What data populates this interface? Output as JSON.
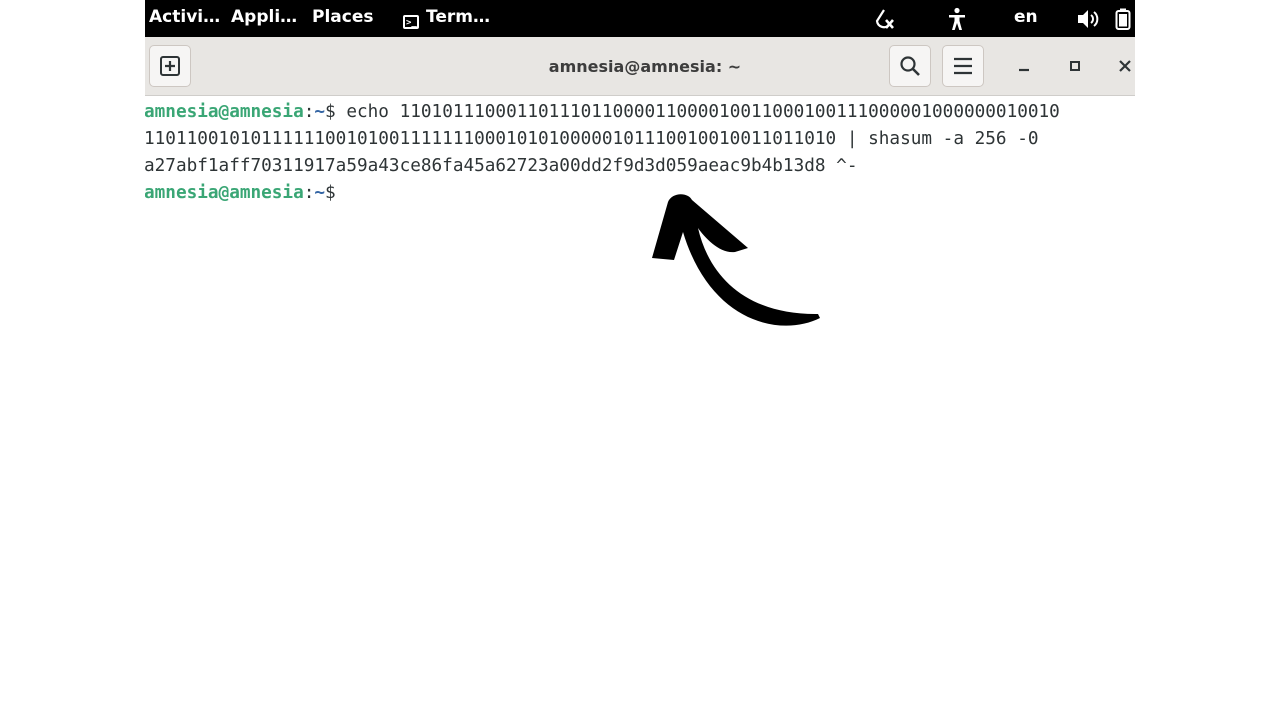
{
  "topbar": {
    "activities": "Activi…",
    "applications": "Appli…",
    "places": "Places",
    "terminal_task": "Term…",
    "language": "en",
    "icons": [
      "network-off-icon",
      "accessibility-icon",
      "volume-icon",
      "battery-icon"
    ]
  },
  "headerbar": {
    "title": "amnesia@amnesia: ~",
    "icons": [
      "new-tab-icon",
      "search-icon",
      "menu-icon",
      "minimize-icon",
      "maximize-icon",
      "close-icon"
    ]
  },
  "terminal": {
    "prompt_user": "amnesia@amnesia",
    "prompt_colon": ":",
    "prompt_path": "~",
    "prompt_symbol": "$",
    "command_line1": " echo 11010111000110111011000011000010011000100111000001000000010010",
    "command_line2": "1101100101011111100101001111111000101010000010111001001001101101‌0 | shasum -a 256 -0",
    "output_line": "a27abf1aff70311917a59a43ce86fa45a62723a00dd2f9d3d059aeac9b4b13d8 ^-"
  },
  "annotation": {
    "arrow_color": "#000000"
  }
}
